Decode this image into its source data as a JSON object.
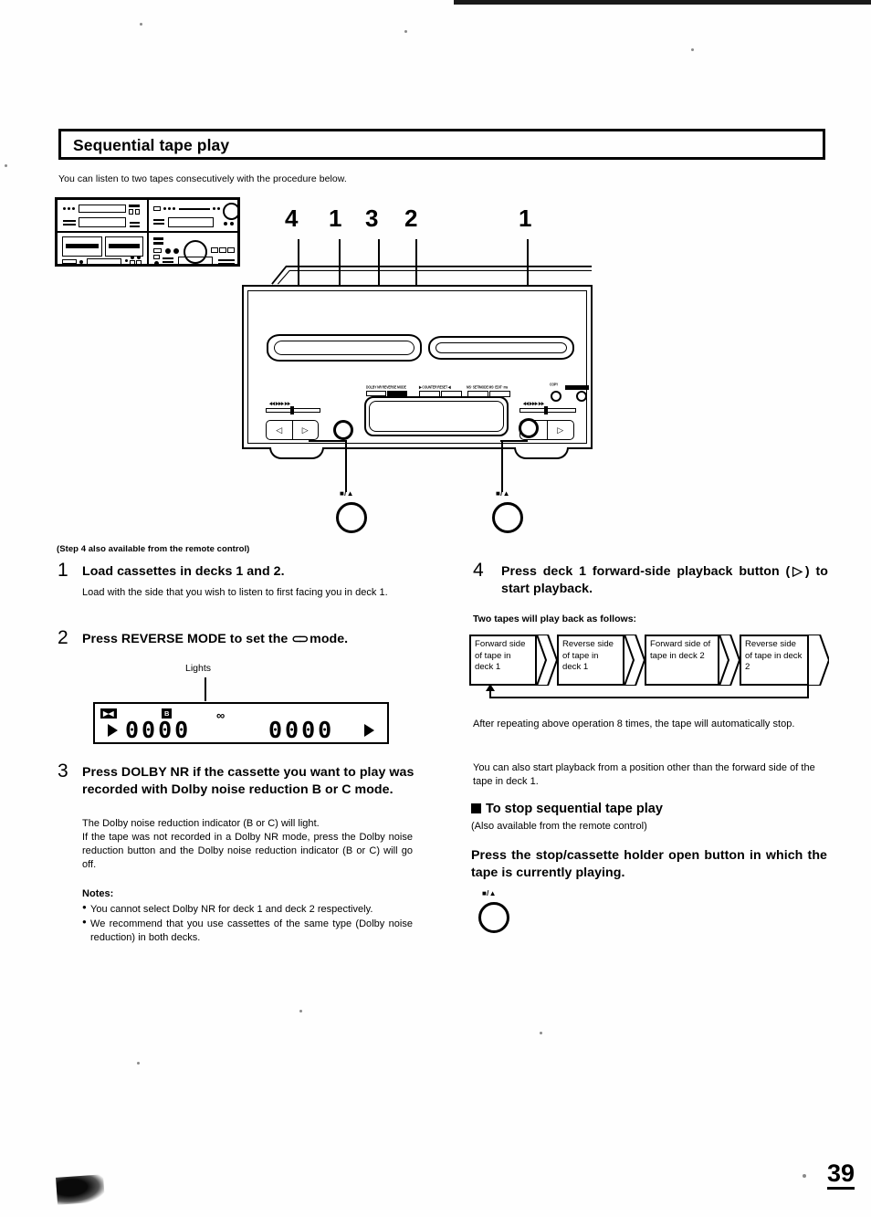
{
  "page": {
    "number": "39",
    "section_title": "Sequential tape play",
    "intro": "You can listen to two tapes consecutively with the procedure below."
  },
  "figure": {
    "callouts": [
      "4",
      "1",
      "3",
      "2",
      "1"
    ],
    "eject_button_label": "■/▲",
    "panel_micro_labels": [
      "DOLBY NR  REVERSE MODE",
      "▶ COUNTER RESET ◀",
      "MS· SET/MODE  MS· EDIT· ms",
      "COPY"
    ],
    "transport_left": "◁",
    "transport_right": "▷",
    "slider_marks": "◀◀   ▶▶▶   ▶▶"
  },
  "left_column": {
    "remote_note": "(Step 4 also available from the remote control)",
    "steps": [
      {
        "num": "1",
        "title": "Load cassettes in decks 1 and 2.",
        "body": "Load with the side that you wish to listen to first facing you in deck 1."
      },
      {
        "num": "2",
        "title_before": "Press REVERSE MODE to set the ",
        "title_symbol": "⊂⊃",
        "title_after": " mode."
      },
      {
        "num": "3",
        "title": "Press DOLBY NR if the cassette you want to play was recorded with Dolby noise reduction B or C mode.",
        "body_line1": "The Dolby noise reduction indicator (B or C) will light.",
        "body_line2": "If the tape was not recorded in a Dolby NR mode, press the Dolby noise reduction button and the Dolby noise reduction indicator (B or C) will go off."
      }
    ],
    "display_figure": {
      "lights_label": "Lights",
      "indicator_1": "▶◀",
      "indicator_2": "B",
      "indicator_3": "∞",
      "counter_left": "0000",
      "counter_right": "0000",
      "arrow_left": "▷",
      "arrow_right": "▷"
    },
    "notes": {
      "heading": "Notes:",
      "items": [
        "You cannot select Dolby NR for deck 1 and deck 2 respectively.",
        "We recommend that you use cassettes of the same type (Dolby noise reduction) in both decks."
      ]
    }
  },
  "right_column": {
    "step4": {
      "num": "4",
      "title": "Press deck 1 forward-side playback button (▷) to start playback."
    },
    "flow_intro": "Two tapes will play back as follows:",
    "flow_boxes": [
      "Forward side of tape in deck 1",
      "Reverse side of tape in deck 1",
      "Forward side of tape in deck 2",
      "Reverse side of tape in deck 2"
    ],
    "after_flow": "After repeating above operation 8 times, the tape will automatically stop.",
    "alt_start": "You can also start playback from a position other than the forward side of the tape in deck 1.",
    "stop_heading": "To stop sequential tape play",
    "stop_sub": "(Also available from the remote control)",
    "stop_instruction": "Press the stop/cassette holder open button in which the tape is currently playing.",
    "stop_button_label": "■/▲"
  }
}
